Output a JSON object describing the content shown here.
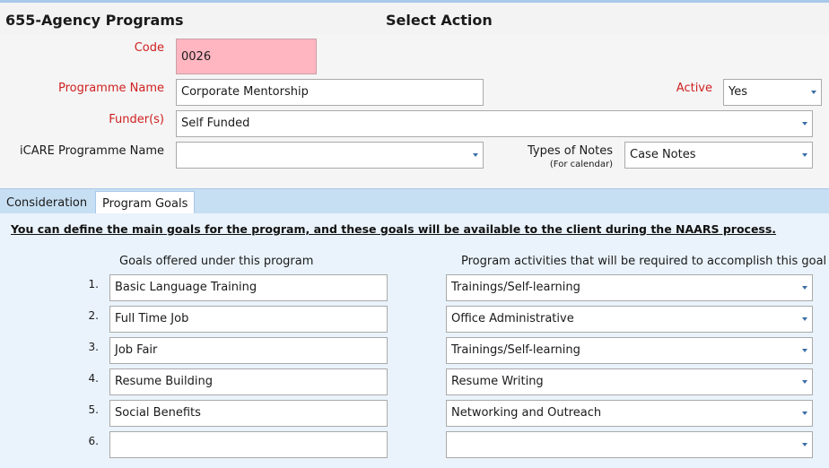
{
  "header": {
    "app_title": "655-Agency Programs",
    "action_title": "Select Action"
  },
  "form": {
    "code": {
      "label": "Code",
      "value": "0026"
    },
    "programme_name": {
      "label": "Programme Name",
      "value": "Corporate Mentorship"
    },
    "active": {
      "label": "Active",
      "value": "Yes"
    },
    "funders": {
      "label": "Funder(s)",
      "value": "Self Funded"
    },
    "icare_programme": {
      "label": "iCARE Programme Name",
      "value": ""
    },
    "notes_type": {
      "label": "Types of Notes",
      "sublabel": "(For calendar)",
      "value": "Case Notes"
    }
  },
  "tabs": [
    {
      "label": "Consideration",
      "active": false
    },
    {
      "label": "Program Goals",
      "active": true
    }
  ],
  "goals_panel": {
    "intro": "You can define the main goals for the program, and these goals will be available to the client during the NAARS process.",
    "goals_header": "Goals offered under this program",
    "activities_header": "Program activities that will be required to accomplish this goal",
    "rows": [
      {
        "num": "1.",
        "goal": "Basic Language Training",
        "activity": "Trainings/Self-learning"
      },
      {
        "num": "2.",
        "goal": "Full Time Job",
        "activity": "Office Administrative"
      },
      {
        "num": "3.",
        "goal": "Job Fair",
        "activity": "Trainings/Self-learning"
      },
      {
        "num": "4.",
        "goal": "Resume Building",
        "activity": "Resume Writing"
      },
      {
        "num": "5.",
        "goal": "Social Benefits",
        "activity": "Networking and Outreach"
      },
      {
        "num": "6.",
        "goal": "",
        "activity": ""
      }
    ]
  },
  "colors": {
    "required_label": "#d02020",
    "code_field_bg": "#ffb6c1",
    "tab_bar": "#c7dff3",
    "panel_bg": "#eaf3fb",
    "dropdown_arrow": "#3a6ea5"
  }
}
